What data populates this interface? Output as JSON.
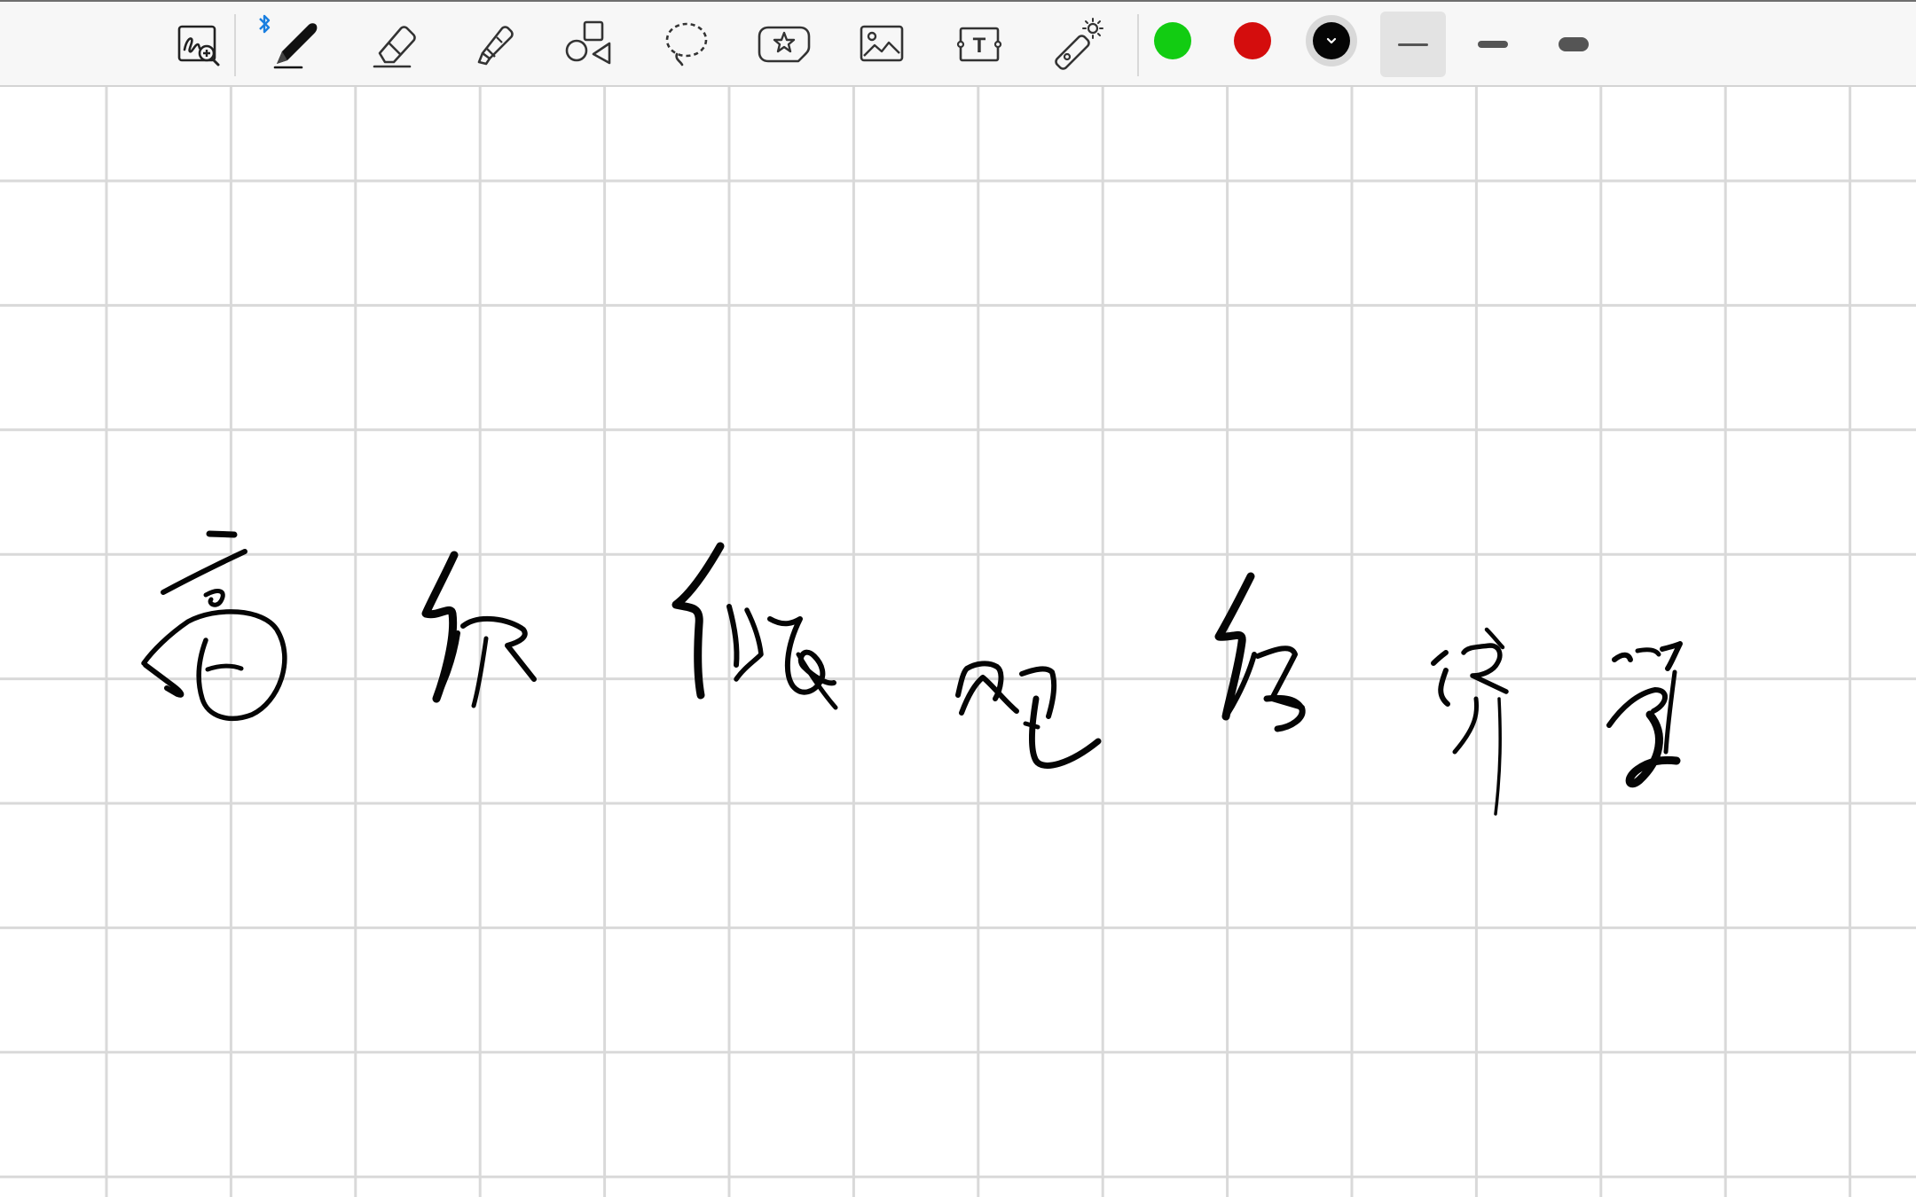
{
  "toolbar": {
    "tools": [
      {
        "name": "page-zoom",
        "icon": "handwriting-zoom-icon"
      },
      {
        "name": "pen",
        "icon": "pen-icon",
        "bluetooth": "bluetooth-icon"
      },
      {
        "name": "eraser",
        "icon": "eraser-icon"
      },
      {
        "name": "highlighter",
        "icon": "highlighter-icon"
      },
      {
        "name": "shapes",
        "icon": "shapes-icon"
      },
      {
        "name": "lasso",
        "icon": "lasso-icon"
      },
      {
        "name": "sticker",
        "icon": "sticker-star-icon"
      },
      {
        "name": "image",
        "icon": "image-icon"
      },
      {
        "name": "text",
        "icon": "text-box-icon",
        "glyph": "T"
      },
      {
        "name": "laser-pointer",
        "icon": "laser-pointer-icon"
      }
    ],
    "colors": [
      {
        "name": "green",
        "hex": "#12cc12"
      },
      {
        "name": "red",
        "hex": "#d40d0d"
      },
      {
        "name": "black",
        "hex": "#050505",
        "selected": true,
        "icon": "chevron-down-icon"
      }
    ],
    "stroke_widths": [
      {
        "name": "thin",
        "selected": true
      },
      {
        "name": "medium",
        "selected": false
      },
      {
        "name": "thick",
        "selected": false
      }
    ]
  },
  "canvas": {
    "background": "grid",
    "grid_color": "#d9d9d9",
    "ink_color": "#050505",
    "handwriting": "高级微观经济学"
  }
}
